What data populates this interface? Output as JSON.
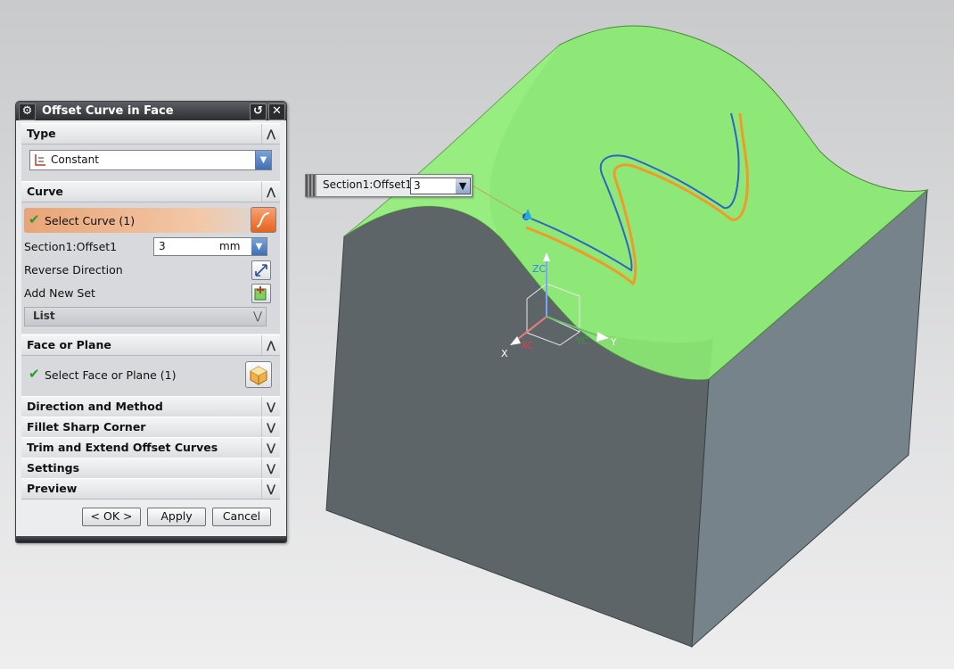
{
  "dialog": {
    "title": "Offset Curve in Face",
    "reset_glyph": "↺",
    "close_glyph": "✕",
    "gear_glyph": "⚙",
    "sections": {
      "type": {
        "title": "Type",
        "dropdown_value": "Constant"
      },
      "curve": {
        "title": "Curve",
        "select_curve_label": "Select Curve (1)",
        "offset_label": "Section1:Offset1",
        "offset_value": "3",
        "offset_unit": "mm",
        "reverse_direction_label": "Reverse Direction",
        "add_new_set_label": "Add New Set",
        "list_label": "List"
      },
      "face": {
        "title": "Face or Plane",
        "select_face_label": "Select Face or Plane (1)"
      },
      "collapsed": [
        {
          "title": "Direction and Method"
        },
        {
          "title": "Fillet Sharp Corner"
        },
        {
          "title": "Trim and Extend Offset Curves"
        },
        {
          "title": "Settings"
        },
        {
          "title": "Preview"
        }
      ]
    },
    "buttons": {
      "ok": "< OK >",
      "apply": "Apply",
      "cancel": "Cancel"
    }
  },
  "floating_input": {
    "label": "Section1:Offset1",
    "value": "3"
  },
  "triad": {
    "zc": "ZC",
    "xc": "XC",
    "yc": "YC",
    "x": "X",
    "y": "Y"
  },
  "colors": {
    "face_top": "#8ee878",
    "solid_left": "#5c6569",
    "solid_right": "#77838a",
    "curve_blue": "#2f63c8",
    "curve_orange": "#f19a2b",
    "select_highlight": "#e9a476"
  },
  "up_chevron": "⋀",
  "down_chevron": "⋁"
}
